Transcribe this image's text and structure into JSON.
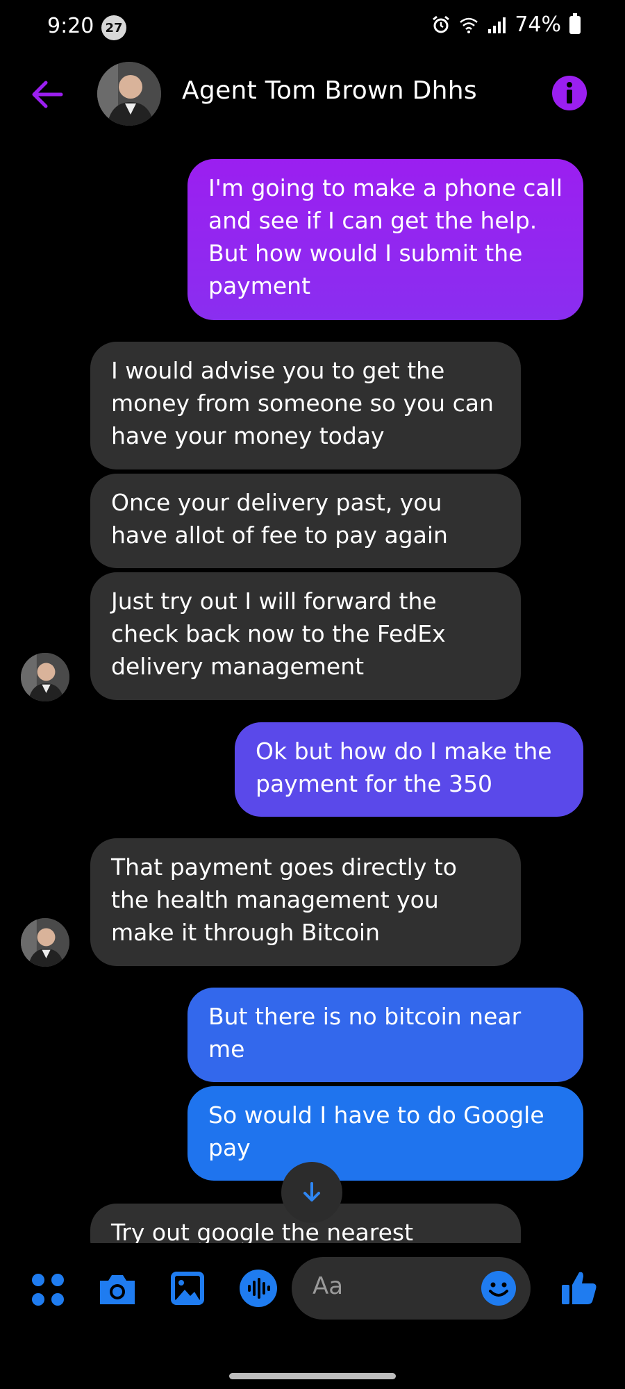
{
  "status_bar": {
    "time": "9:20",
    "notification_count": "27",
    "battery": "74%"
  },
  "header": {
    "contact_name": "Agent Tom Brown Dhhs"
  },
  "messages": [
    {
      "from": "me",
      "text": "I'm going to make a phone call and see if I can get the help. But how would I submit the payment"
    },
    {
      "from": "them",
      "text": "I would advise you to get the money from someone so you can have your money today"
    },
    {
      "from": "them",
      "text": "Once your delivery past, you have allot of fee to pay again"
    },
    {
      "from": "them",
      "text": "Just try out I will forward the check back now to the FedEx delivery management"
    },
    {
      "from": "me",
      "text": "Ok but how do I make the payment for the 350"
    },
    {
      "from": "them",
      "text": "That payment goes directly to the health management you make it through Bitcoin"
    },
    {
      "from": "me",
      "text": "But there is no bitcoin near me"
    },
    {
      "from": "me",
      "text": "So would I have to do Google pay"
    },
    {
      "from": "them",
      "text": "Try out google the nearest"
    }
  ],
  "composer": {
    "placeholder": "Aa"
  },
  "colors": {
    "accent_purple": "#9b1ff0",
    "bubble_incoming": "#303030",
    "bubble_blue": "#2f6fea",
    "icon_blue": "#1f7cf0"
  }
}
